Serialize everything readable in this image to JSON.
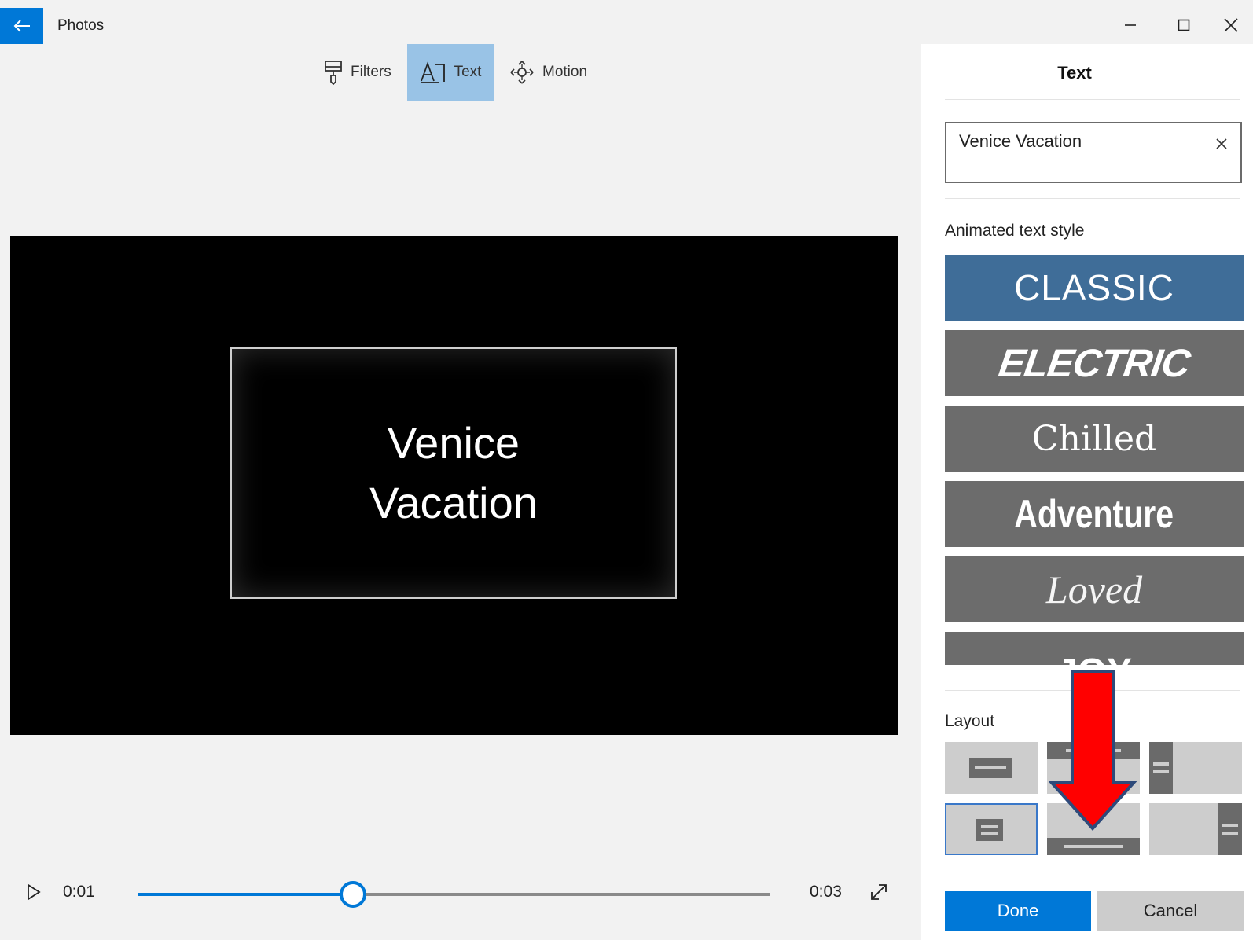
{
  "app": {
    "title": "Photos"
  },
  "toolbar": {
    "filters_label": "Filters",
    "text_label": "Text",
    "motion_label": "Motion",
    "active_tab": "Text"
  },
  "preview": {
    "title_text": "Venice Vacation"
  },
  "playback": {
    "current_time": "0:01",
    "end_time": "0:03",
    "progress": 0.34
  },
  "panel": {
    "title": "Text",
    "text_value": "Venice Vacation",
    "styles_label": "Animated text style",
    "styles": [
      {
        "label": "CLASSIC",
        "selected": true
      },
      {
        "label": "ELECTRIC",
        "selected": false
      },
      {
        "label": "Chilled",
        "selected": false
      },
      {
        "label": "Adventure",
        "selected": false
      },
      {
        "label": "Loved",
        "selected": false
      },
      {
        "label": "JOY",
        "selected": false
      }
    ],
    "layout_label": "Layout",
    "selected_layout": "center",
    "done_label": "Done",
    "cancel_label": "Cancel"
  },
  "colors": {
    "accent": "#0078d7",
    "selected_tab": "#99c3e6",
    "selected_style": "#3f6d98",
    "style_tile": "#6c6c6c",
    "annotation_arrow": "#ff0000"
  }
}
